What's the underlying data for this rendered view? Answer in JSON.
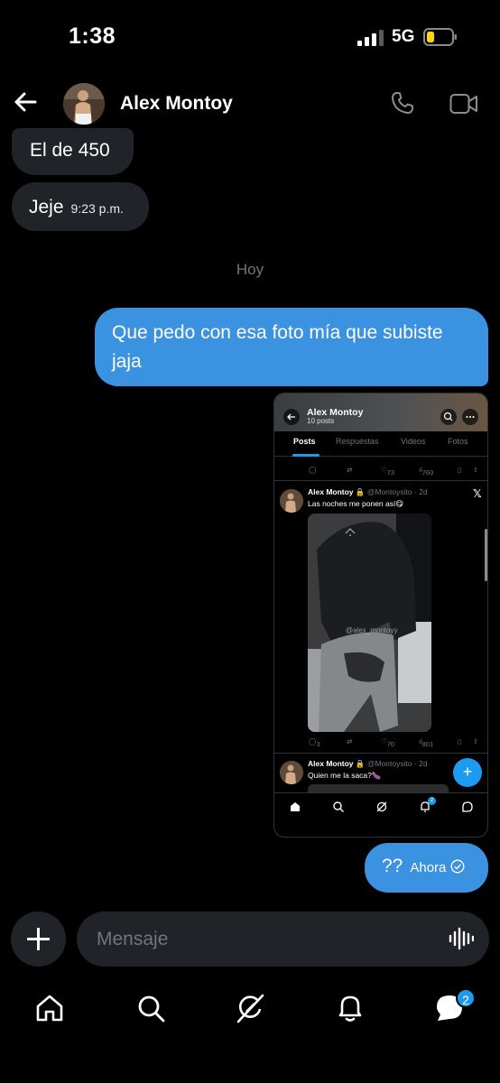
{
  "status_bar": {
    "time": "1:38",
    "network": "5G"
  },
  "header": {
    "contact_name": "Alex Montoy"
  },
  "messages": {
    "incoming_1": "El de 450",
    "incoming_2": "Jeje",
    "incoming_2_time": "9:23 p.m.",
    "day_divider": "Hoy",
    "outgoing_1": "Que pedo con esa foto mía que subiste jaja",
    "outgoing_2": "??",
    "outgoing_2_time": "Ahora"
  },
  "shared_screenshot": {
    "profile_name": "Alex Montoy",
    "posts_count": "10 posts",
    "tabs": [
      "Posts",
      "Respuestas",
      "Videos",
      "Fotos"
    ],
    "top_stats": {
      "likes": "73",
      "views": "760"
    },
    "tweet_1": {
      "name": "Alex Montoy",
      "handle": "@Montoysito · 2d",
      "text": "Las noches me ponen así😋",
      "watermark": "@alex_montoyy",
      "replies": "3",
      "likes": "70",
      "views": "801"
    },
    "tweet_2": {
      "name": "Alex Montoy",
      "handle": "@Montoysito · 2d",
      "text": "Quien me la saca?🍆"
    },
    "fab_label": "+",
    "notifications_badge": "2"
  },
  "composer": {
    "placeholder": "Mensaje"
  },
  "bottom_nav": {
    "messages_badge": "2"
  },
  "colors": {
    "outgoing_bubble": "#3a92e0",
    "incoming_bubble": "#202327",
    "accent": "#1d9bf0"
  }
}
